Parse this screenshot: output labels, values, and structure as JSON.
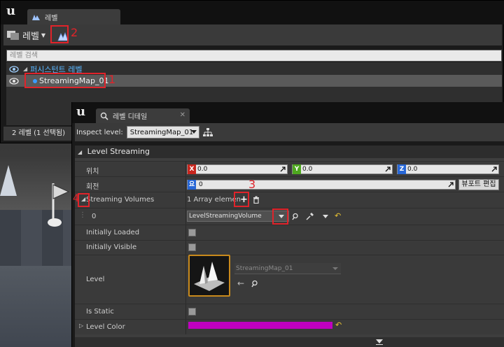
{
  "levels_window": {
    "tab_title": "레벨",
    "toolbar_levels_label": "레벨",
    "search_placeholder": "레벨 검색",
    "persistent_level": "퍼시스턴트 레벨",
    "sublevel": "StreamingMap_01",
    "status": "2 레벨 (1 선택됨)"
  },
  "details_window": {
    "tab_title": "레벨 디테일",
    "inspect_label": "Inspect level:",
    "inspect_value": "StreamingMap_01",
    "category": "Level Streaming",
    "location_label": "위치",
    "location": {
      "x_tag": "X",
      "x": "0.0",
      "y_tag": "Y",
      "y": "0.0",
      "z_tag": "Z",
      "z": "0.0"
    },
    "rotation_label": "회전",
    "rotation": {
      "tag": "요",
      "value": "0"
    },
    "viewport_edit_button": "뷰포트 편집",
    "streaming_volumes_label": "Streaming Volumes",
    "array_elements": "1 Array elemen",
    "element_index": "0",
    "element_value": "LevelStreamingVolume",
    "initially_loaded": "Initially Loaded",
    "initially_visible": "Initially Visible",
    "level_label": "Level",
    "level_value": "StreamingMap_01",
    "is_static": "Is Static",
    "level_color": "Level Color",
    "level_color_hex": "#c000c0"
  },
  "annotations": {
    "n1": "1",
    "n2": "2",
    "n3": "3",
    "n4": "4"
  },
  "colors": {
    "accent_red": "#e0232a",
    "persistent_blue": "#5ab6ff",
    "thumb_border": "#c98a1c"
  }
}
